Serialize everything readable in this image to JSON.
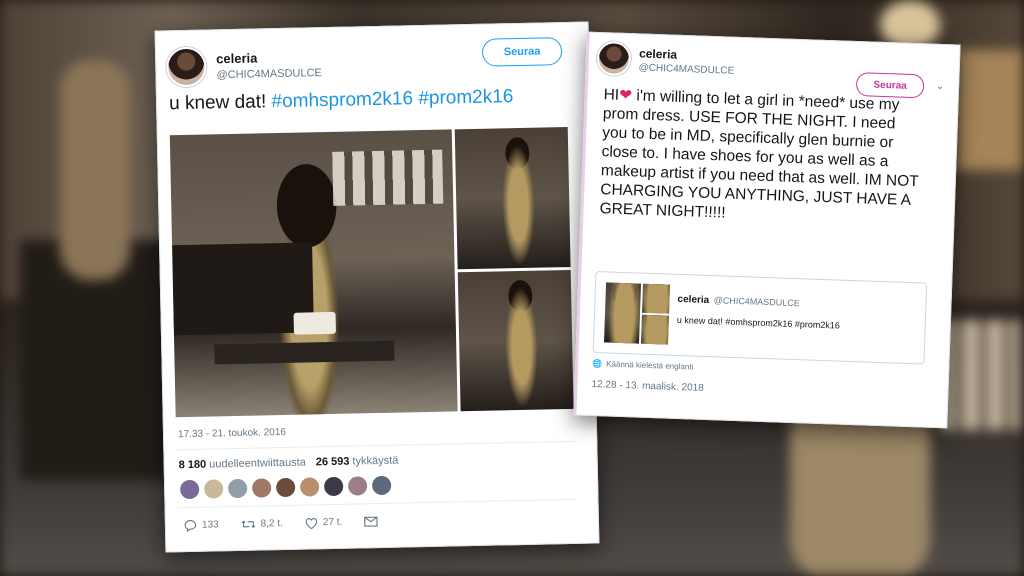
{
  "left_tweet": {
    "name": "celeria",
    "handle": "@CHIC4MASDULCE",
    "follow_label": "Seuraa",
    "text_plain": "u knew dat! ",
    "hashtag1": "#omhsprom2k16",
    "hashtag2": "#prom2k16",
    "timestamp": "17.33 - 21. toukok. 2016",
    "retweets_count": "8 180",
    "retweets_label": "uudelleentwiittausta",
    "likes_count": "26 593",
    "likes_label": "tykkäystä",
    "liker_colors": [
      "#7a6a9a",
      "#c9b89a",
      "#8f9ea8",
      "#a07868",
      "#6b4d3a",
      "#b89070",
      "#3a3a4a",
      "#9a7f88",
      "#5a6a7a"
    ],
    "reply_count": "133",
    "retweet_count_short": "8,2 t.",
    "like_count_short": "27 t."
  },
  "right_tweet": {
    "name": "celeria",
    "handle": "@CHIC4MASDULCE",
    "follow_label": "Seuraa",
    "hi": "HI",
    "heart_icon": "sparkling-heart",
    "text": "i'm willing to let a girl in *need* use my prom dress. USE FOR THE NIGHT. I need you to be in MD, specifically glen burnie or close to. I have shoes for you as well as a makeup artist if you need that as well. IM NOT CHARGING YOU ANYTHING, JUST HAVE A GREAT NIGHT!!!!!",
    "quote": {
      "name": "celeria",
      "handle": "@CHIC4MASDULCE",
      "text": "u knew dat! #omhsprom2k16 #prom2k16"
    },
    "translate_label": "Käännä kielestä englanti",
    "timestamp": "12.28 - 13. maalisk. 2018"
  },
  "colors": {
    "hashtag": "#1b95e0",
    "follow_blue": "#1da1f2",
    "follow_pink": "#c4379c",
    "meta_gray": "#657786"
  }
}
